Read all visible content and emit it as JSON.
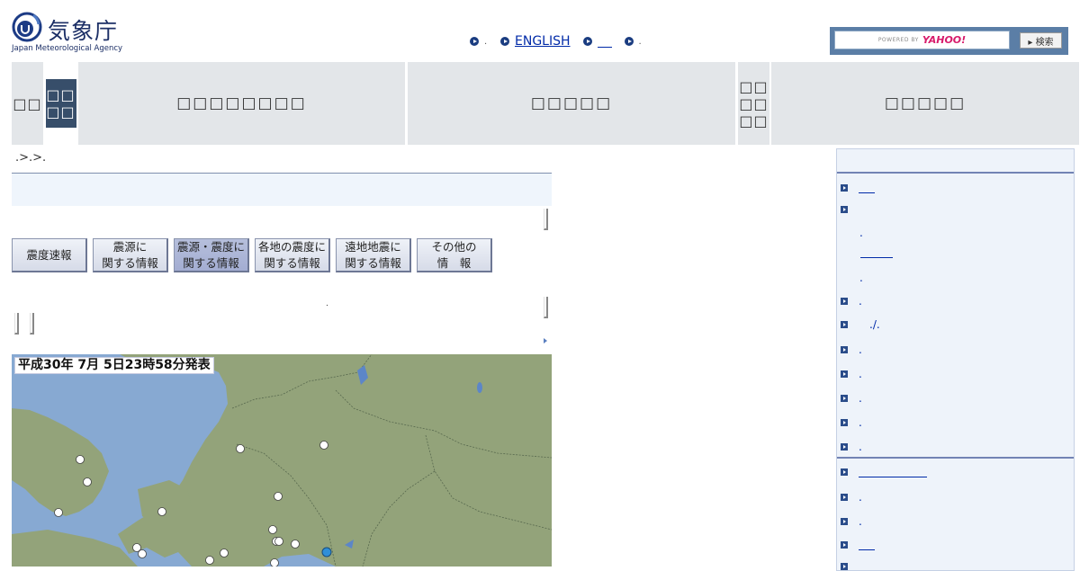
{
  "header": {
    "logo_ja": "気象庁",
    "logo_en": "Japan Meteorological Agency",
    "links": [
      {
        "label": ".",
        "style": "stub"
      },
      {
        "label": "ENGLISH",
        "style": "link"
      },
      {
        "label": "",
        "style": "underline"
      },
      {
        "label": ".",
        "style": "stub"
      }
    ],
    "search": {
      "powered_by": "POWERED BY",
      "provider": "YAHOO!",
      "button": "▸ 検索"
    }
  },
  "nav": {
    "items": [
      {
        "label": "□□",
        "style": "small"
      },
      {
        "label": "□□\n□□",
        "style": "active"
      },
      {
        "label": "□□□□□□□□",
        "style": "large"
      },
      {
        "label": "□□□□□",
        "style": "large"
      },
      {
        "label": "□□\n□□\n□□",
        "style": "small"
      },
      {
        "label": "□□□□□",
        "style": "large"
      }
    ]
  },
  "breadcrumb": ".>.>.",
  "tabs": [
    {
      "line1": "震度速報",
      "line2": "",
      "active": false
    },
    {
      "line1": "震源に",
      "line2": "関する情報",
      "active": false
    },
    {
      "line1": "震源・震度に",
      "line2": "関する情報",
      "active": true
    },
    {
      "line1": "各地の震度に",
      "line2": "関する情報",
      "active": false
    },
    {
      "line1": "遠地地震に",
      "line2": "関する情報",
      "active": false
    },
    {
      "line1": "その他の",
      "line2": "情　報",
      "active": false
    }
  ],
  "map": {
    "issued_label": "平成30年 7月 5日23時58分発表",
    "colors": {
      "sea": "#87a9d2",
      "land": "#93a37a",
      "epicenter": "#2f8fd8",
      "station": "#ffffff"
    }
  },
  "sidebar": {
    "items": [
      {
        "label": "",
        "kind": "underline",
        "width": 18
      },
      {
        "label": "",
        "kind": "plain"
      },
      {
        "label": ".",
        "kind": "sub"
      },
      {
        "label": "",
        "kind": "sub-underline",
        "width": 36
      },
      {
        "label": ".",
        "kind": "sub"
      },
      {
        "label": ".",
        "kind": "plain"
      },
      {
        "label": "./.",
        "kind": "plain"
      },
      {
        "label": ".",
        "kind": "plain"
      },
      {
        "label": ".",
        "kind": "plain"
      },
      {
        "label": ".",
        "kind": "plain"
      },
      {
        "label": ".",
        "kind": "plain"
      },
      {
        "label": ".",
        "kind": "plain"
      },
      {
        "label": "",
        "kind": "underline",
        "width": 76
      },
      {
        "label": ".",
        "kind": "plain"
      },
      {
        "label": ".",
        "kind": "plain"
      },
      {
        "label": "",
        "kind": "underline",
        "width": 18
      }
    ]
  }
}
